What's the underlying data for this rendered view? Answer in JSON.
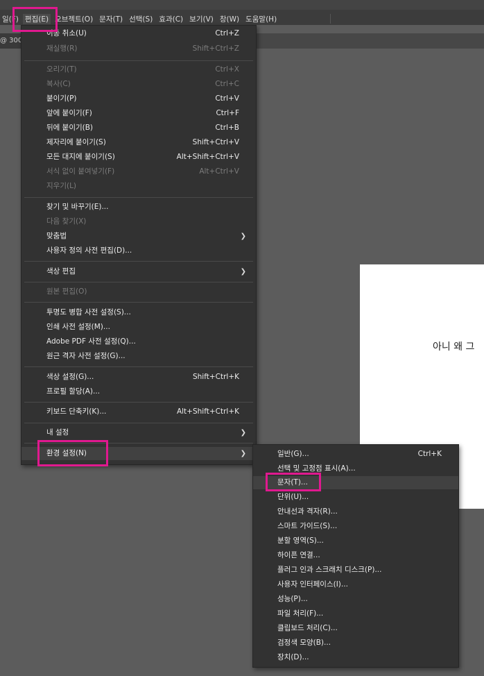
{
  "menubar": {
    "items": [
      "일(F)",
      "편집(E)",
      "오브젝트(O)",
      "문자(T)",
      "선택(S)",
      "효과(C)",
      "보기(V)",
      "창(W)",
      "도움말(H)"
    ]
  },
  "doc_tab": {
    "label": "@ 300"
  },
  "artboard": {
    "text": "아니 왜 그"
  },
  "edit_menu": {
    "undo": {
      "label": "이동 취소(U)",
      "shortcut": "Ctrl+Z"
    },
    "redo": {
      "label": "재실행(R)",
      "shortcut": "Shift+Ctrl+Z"
    },
    "cut": {
      "label": "오리기(T)",
      "shortcut": "Ctrl+X"
    },
    "copy": {
      "label": "복사(C)",
      "shortcut": "Ctrl+C"
    },
    "paste": {
      "label": "붙이기(P)",
      "shortcut": "Ctrl+V"
    },
    "paste_front": {
      "label": "앞에 붙이기(F)",
      "shortcut": "Ctrl+F"
    },
    "paste_back": {
      "label": "뒤에 붙이기(B)",
      "shortcut": "Ctrl+B"
    },
    "paste_in_place": {
      "label": "제자리에 붙이기(S)",
      "shortcut": "Shift+Ctrl+V"
    },
    "paste_all_artboards": {
      "label": "모든 대지에 붙이기(S)",
      "shortcut": "Alt+Shift+Ctrl+V"
    },
    "paste_no_format": {
      "label": "서식 없이 붙여넣기(F)",
      "shortcut": "Alt+Ctrl+V"
    },
    "clear": {
      "label": "지우기(L)"
    },
    "find_replace": {
      "label": "찾기 및 바꾸기(E)..."
    },
    "find_next": {
      "label": "다음 찾기(X)"
    },
    "spelling": {
      "label": "맞춤법"
    },
    "custom_dictionary": {
      "label": "사용자 정의 사전 편집(D)..."
    },
    "edit_colors": {
      "label": "색상 편집"
    },
    "edit_original": {
      "label": "원본 편집(O)"
    },
    "transparency_presets": {
      "label": "투명도 병합 사전 설정(S)..."
    },
    "print_presets": {
      "label": "인쇄 사전 설정(M)..."
    },
    "pdf_presets": {
      "label": "Adobe PDF 사전 설정(Q)..."
    },
    "perspective_presets": {
      "label": "원근 격자 사전 설정(G)..."
    },
    "color_settings": {
      "label": "색상 설정(G)...",
      "shortcut": "Shift+Ctrl+K"
    },
    "assign_profile": {
      "label": "프로필 할당(A)..."
    },
    "keyboard_shortcuts": {
      "label": "키보드 단축키(K)...",
      "shortcut": "Alt+Shift+Ctrl+K"
    },
    "my_settings": {
      "label": "내 설정"
    },
    "preferences": {
      "label": "환경 설정(N)"
    }
  },
  "preferences_menu": {
    "general": {
      "label": "일반(G)...",
      "shortcut": "Ctrl+K"
    },
    "selection_anchor": {
      "label": "선택 및 고정점 표시(A)..."
    },
    "type": {
      "label": "문자(T)..."
    },
    "units": {
      "label": "단위(U)..."
    },
    "guides_grid": {
      "label": "안내선과 격자(R)..."
    },
    "smart_guides": {
      "label": "스마트 가이드(S)..."
    },
    "slices": {
      "label": "분할 영역(S)..."
    },
    "hyphenation": {
      "label": "하이픈 연결..."
    },
    "plugins_scratch": {
      "label": "플러그 인과 스크래치 디스크(P)..."
    },
    "user_interface": {
      "label": "사용자 인터페이스(I)..."
    },
    "performance": {
      "label": "성능(P)..."
    },
    "file_handling": {
      "label": "파일 처리(F)..."
    },
    "clipboard": {
      "label": "클립보드 처리(C)..."
    },
    "black_appearance": {
      "label": "검정색 모양(B)..."
    },
    "devices": {
      "label": "장치(D)..."
    }
  },
  "colors": {
    "highlight": "#e0198f",
    "menu_bg": "#323232",
    "canvas_bg": "#5c5c5c"
  }
}
